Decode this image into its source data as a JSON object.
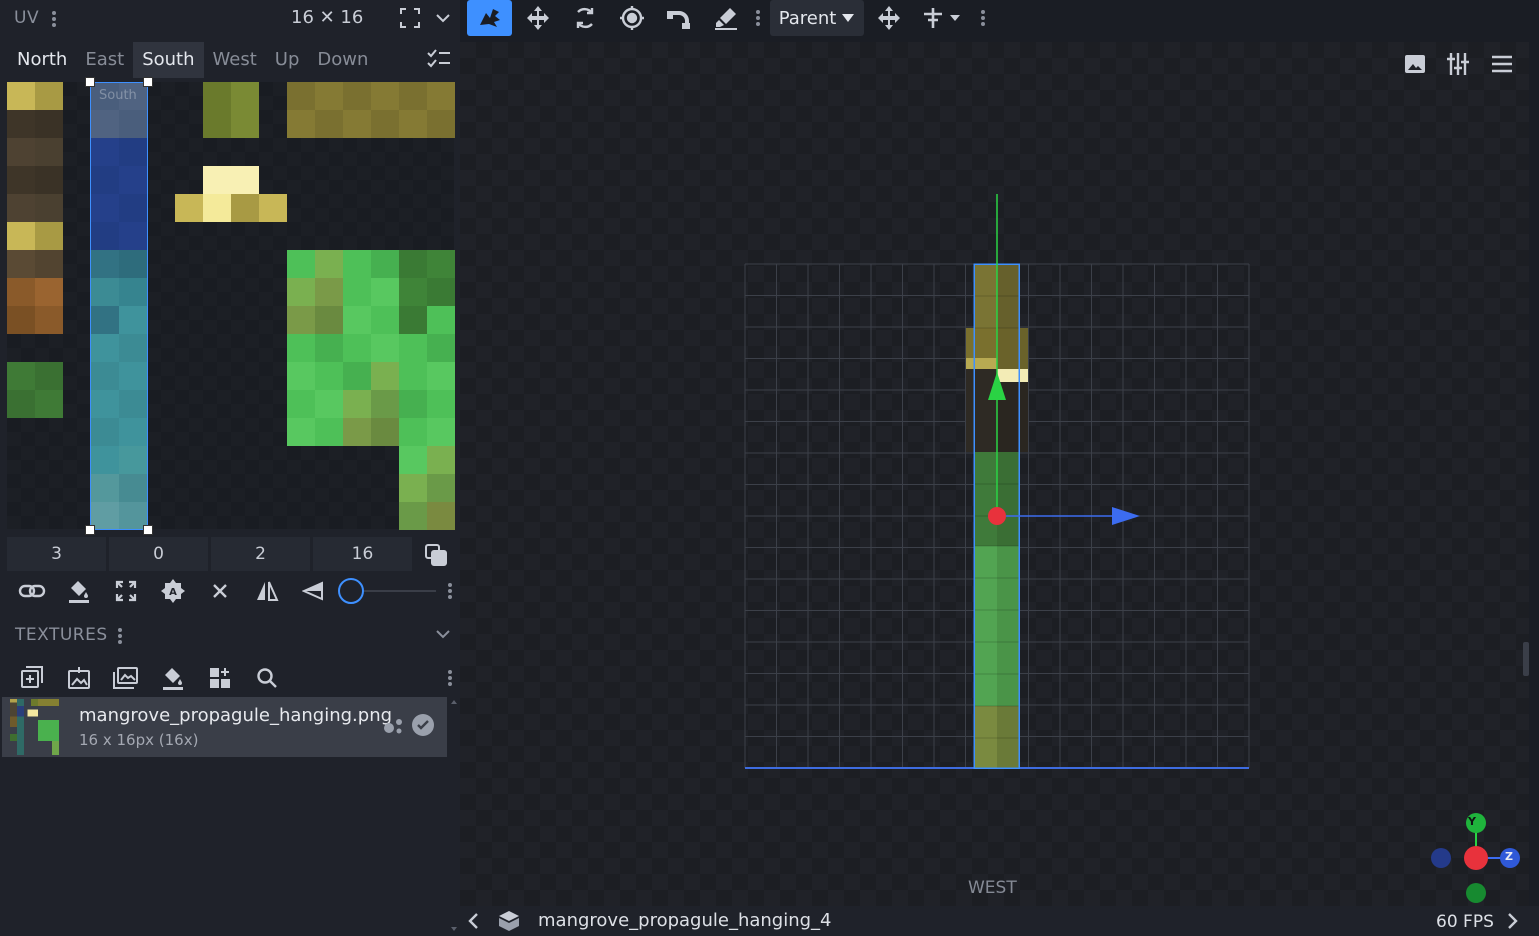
{
  "uv_panel": {
    "title": "UV",
    "resolution": "16 ✕ 16",
    "faces": [
      "North",
      "East",
      "South",
      "West",
      "Up",
      "Down"
    ],
    "active_face": "South",
    "face_label": "South",
    "uv_values": [
      "3",
      "0",
      "2",
      "16"
    ]
  },
  "textures": {
    "title": "TEXTURES",
    "items": [
      {
        "name": "mangrove_propagule_hanging.png",
        "size": "16 x 16px (16x)"
      }
    ]
  },
  "toolbar": {
    "pivot_mode": "Parent"
  },
  "viewport": {
    "view_label": "WEST",
    "gizmo": {
      "y": "Y",
      "z": "Z"
    }
  },
  "status": {
    "outliner_selected": "mangrove_propagule_hanging_4",
    "fps": "60 FPS"
  },
  "colors": {
    "accent": "#3e90ff",
    "active_tool": "#3e90ff",
    "axis_x": "#e8323c",
    "axis_y": "#2ad344",
    "axis_z": "#3c6cf0"
  }
}
